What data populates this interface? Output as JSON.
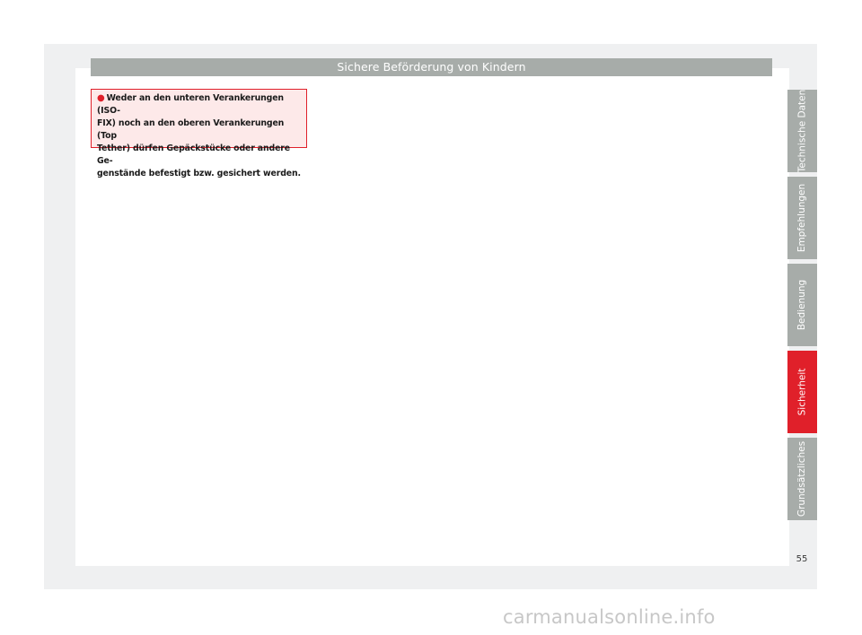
{
  "header": {
    "title": "Sichere Beförderung von Kindern"
  },
  "warning": {
    "bullet": "●",
    "text": "Weder an den unteren Verankerungen (ISO-\nFIX) noch an den oberen Verankerungen (Top\nTether) dürfen Gepäckstücke oder andere Ge-\ngenstände befestigt bzw. gesichert werden."
  },
  "tabs": [
    {
      "label": "Technische Daten",
      "active": false
    },
    {
      "label": "Empfehlungen",
      "active": false
    },
    {
      "label": "Bedienung",
      "active": false
    },
    {
      "label": "Sicherheit",
      "active": true
    },
    {
      "label": "Grundsätzliches",
      "active": false
    }
  ],
  "colors": {
    "accent": "#e0202a",
    "tab_gray": "#a7aca9",
    "frame_bg": "#eff0f1",
    "warning_bg": "#fde9e9"
  },
  "page": {
    "number": "55"
  },
  "watermark": {
    "text": "carmanualsonline.info"
  }
}
